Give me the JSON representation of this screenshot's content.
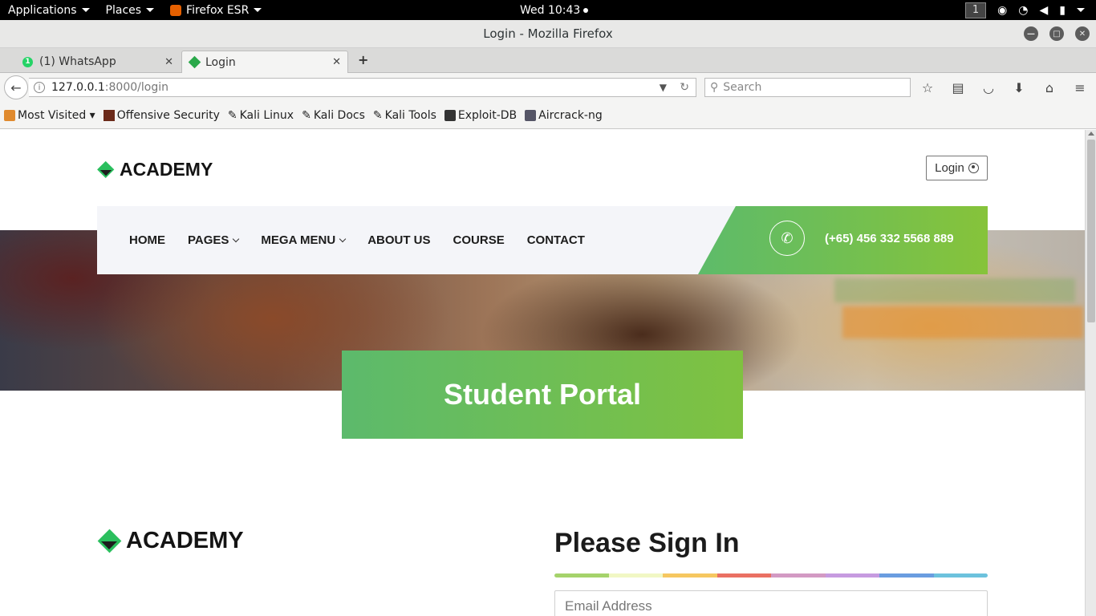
{
  "topbar": {
    "applications": "Applications",
    "places": "Places",
    "firefox": "Firefox ESR",
    "clock": "Wed 10:43",
    "workspace": "1"
  },
  "window": {
    "title": "Login - Mozilla Firefox"
  },
  "tabs": [
    {
      "label": "(1) WhatsApp",
      "badge": "1"
    },
    {
      "label": "Login"
    }
  ],
  "navbar": {
    "url_host": "127.0.0.1",
    "url_path": ":8000/login",
    "search_placeholder": "Search"
  },
  "bookmarks": [
    {
      "label": "Most Visited ▾"
    },
    {
      "label": "Offensive Security"
    },
    {
      "label": "Kali Linux"
    },
    {
      "label": "Kali Docs"
    },
    {
      "label": "Kali Tools"
    },
    {
      "label": "Exploit-DB"
    },
    {
      "label": "Aircrack-ng"
    }
  ],
  "site": {
    "logo": "ACADEMY",
    "login_button": "Login",
    "menu": [
      {
        "label": "HOME"
      },
      {
        "label": "PAGES"
      },
      {
        "label": "MEGA MENU"
      },
      {
        "label": "ABOUT US"
      },
      {
        "label": "COURSE"
      },
      {
        "label": "CONTACT"
      }
    ],
    "phone": "(+65) 456 332 5568 889",
    "banner_title": "Student Portal",
    "signin_title": "Please Sign In",
    "email_placeholder": "Email Address",
    "accent_colors": [
      "#a5d36b",
      "#f1f7c4",
      "#f6c760",
      "#ea7063",
      "#d39ac3",
      "#c69be0",
      "#6a9de0",
      "#6cc2dd"
    ]
  }
}
